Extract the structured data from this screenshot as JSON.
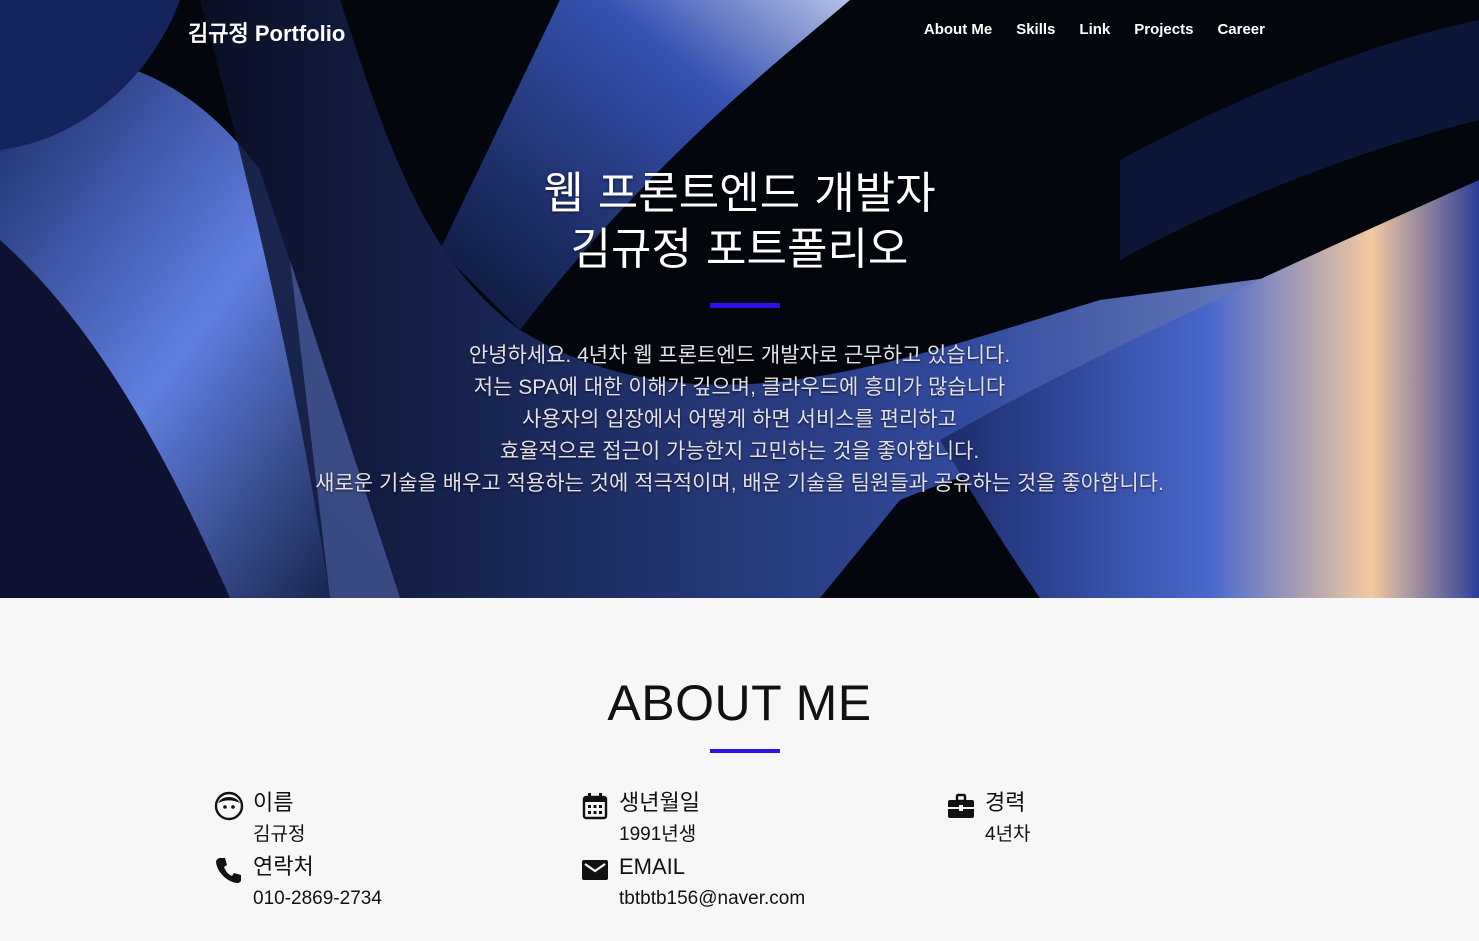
{
  "nav": {
    "brand": "김규정 Portfolio",
    "items": [
      {
        "label": "About Me"
      },
      {
        "label": "Skills"
      },
      {
        "label": "Link"
      },
      {
        "label": "Projects"
      },
      {
        "label": "Career"
      }
    ]
  },
  "hero": {
    "title_line1": "웹 프론트엔드 개발자",
    "title_line2": "김규정 포트폴리오",
    "intro": [
      "안녕하세요. 4년차 웹 프론트엔드 개발자로 근무하고 있습니다.",
      "저는 SPA에 대한 이해가 깊으며, 클라우드에 흥미가 많습니다",
      "사용자의 입장에서 어떻게 하면 서비스를 편리하고",
      "효율적으로 접근이 가능한지 고민하는 것을 좋아합니다.",
      "새로운 기술을 배우고 적용하는 것에 적극적이며, 배운 기술을 팀원들과 공유하는 것을 좋아합니다."
    ]
  },
  "about": {
    "title": "ABOUT ME",
    "name": {
      "icon": "face-icon",
      "label": "이름",
      "value": "김규정"
    },
    "birth": {
      "icon": "calendar-icon",
      "label": "생년월일",
      "value": "1991년생"
    },
    "career": {
      "icon": "briefcase-icon",
      "label": "경력",
      "value": "4년차"
    },
    "phone": {
      "icon": "phone-icon",
      "label": "연락처",
      "value": "010-2869-2734"
    },
    "email": {
      "icon": "mail-icon",
      "label": "EMAIL",
      "value": "tbtbtb156@naver.com"
    }
  },
  "colors": {
    "accent": "#2b13e8",
    "hero_bg": "#05070f",
    "section_bg": "#f7f7f7"
  }
}
